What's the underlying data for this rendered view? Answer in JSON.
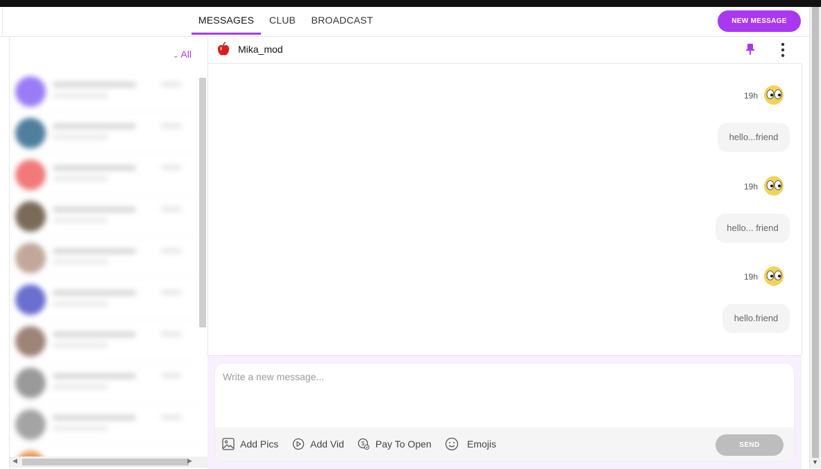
{
  "nav": {
    "tabs": [
      {
        "label": "MESSAGES",
        "active": true
      },
      {
        "label": "CLUB",
        "active": false
      },
      {
        "label": "BROADCAST",
        "active": false
      }
    ],
    "new_message_label": "NEW MESSAGE"
  },
  "sidebar": {
    "filter_label": "All",
    "filter_icon": "chevron-down-icon"
  },
  "chat": {
    "contact_name": "Mika_mod",
    "contact_avatar_icon": "apple-icon",
    "header_icons": [
      "pin-icon",
      "more-vertical-icon"
    ],
    "messages": [
      {
        "time": "19h",
        "text": "hello...friend"
      },
      {
        "time": "19h",
        "text": "hello... friend"
      },
      {
        "time": "19h",
        "text": "hello.friend"
      }
    ]
  },
  "composer": {
    "placeholder": "Write a new message...",
    "tools": [
      {
        "icon": "image-icon",
        "label": "Add Pics"
      },
      {
        "icon": "play-icon",
        "label": "Add Vid"
      },
      {
        "icon": "pay-icon",
        "label": "Pay To Open"
      },
      {
        "icon": "smile-icon",
        "label": "Emojis"
      }
    ],
    "send_label": "SEND"
  },
  "colors": {
    "accent": "#a938f0",
    "composer_bg": "#f8efff",
    "send_disabled": "#bdbdbd"
  }
}
